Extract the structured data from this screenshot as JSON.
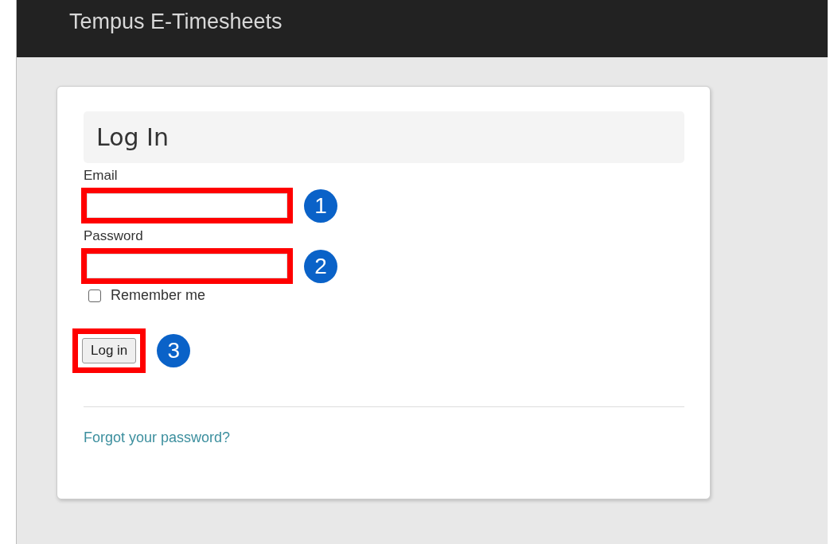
{
  "header": {
    "title": "Tempus E-Timesheets"
  },
  "card": {
    "heading": "Log In",
    "fields": [
      {
        "label": "Email",
        "callout": "1"
      },
      {
        "label": "Password",
        "callout": "2"
      }
    ],
    "remember": {
      "label": "Remember me",
      "checked": false
    },
    "button": {
      "label": "Log in",
      "callout": "3"
    },
    "link": "Forgot your password?"
  }
}
